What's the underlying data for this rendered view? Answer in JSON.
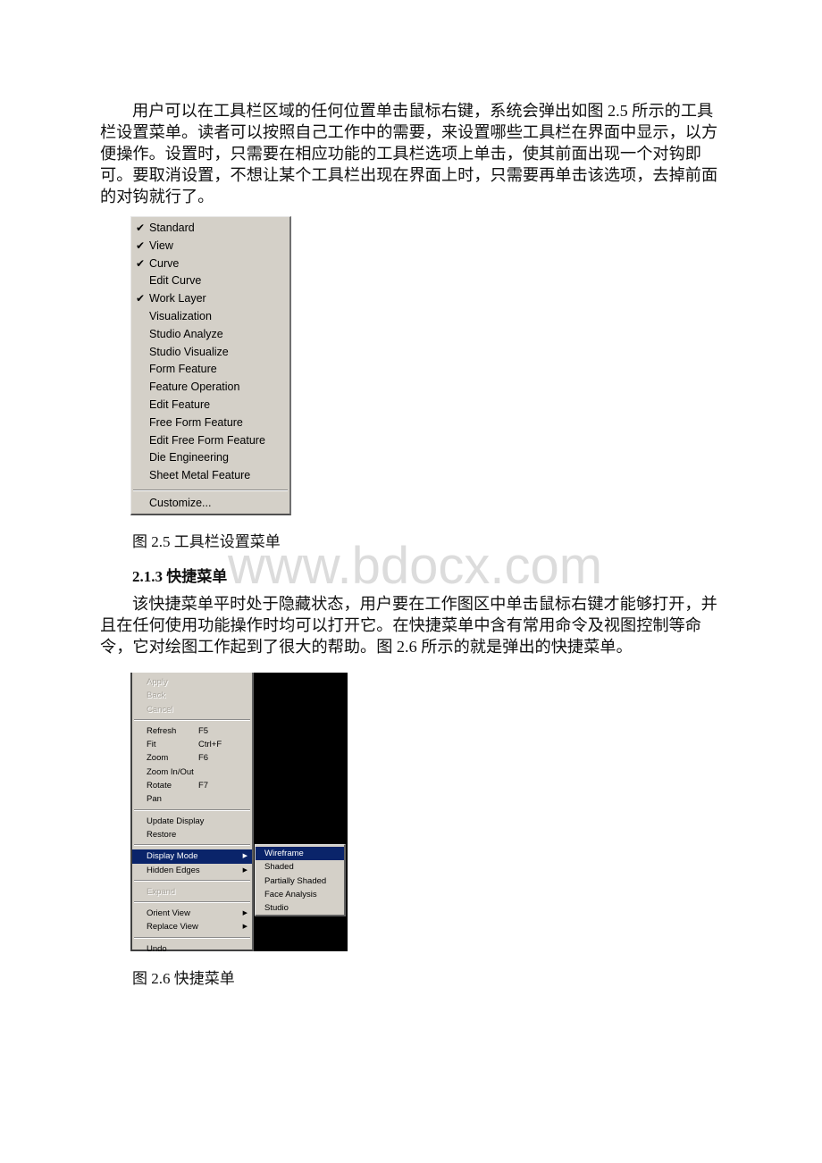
{
  "paragraph1": "用户可以在工具栏区域的任何位置单击鼠标右键，系统会弹出如图 2.5 所示的工具栏设置菜单。读者可以按照自己工作中的需要，来设置哪些工具栏在界面中显示，以方便操作。设置时，只需要在相应功能的工具栏选项上单击，使其前面出现一个对钩即可。要取消设置，不想让某个工具栏出现在界面上时，只需要再单击该选项，去掉前面的对钩就行了。",
  "toolbar_menu": {
    "check_glyph": "✔",
    "items": [
      {
        "label": "Standard",
        "checked": true
      },
      {
        "label": "View",
        "checked": true
      },
      {
        "label": "Curve",
        "checked": true
      },
      {
        "label": "Edit Curve",
        "checked": false
      },
      {
        "label": "Work Layer",
        "checked": true
      },
      {
        "label": "Visualization",
        "checked": false
      },
      {
        "label": "Studio Analyze",
        "checked": false
      },
      {
        "label": "Studio Visualize",
        "checked": false
      },
      {
        "label": "Form Feature",
        "checked": false
      },
      {
        "label": "Feature Operation",
        "checked": false
      },
      {
        "label": "Edit Feature",
        "checked": false
      },
      {
        "label": "Free Form Feature",
        "checked": false
      },
      {
        "label": "Edit Free Form Feature",
        "checked": false
      },
      {
        "label": "Die Engineering",
        "checked": false
      },
      {
        "label": "Sheet Metal Feature",
        "checked": false
      }
    ],
    "customize_label": "Customize..."
  },
  "caption1": "图 2.5 工具栏设置菜单",
  "section_heading": "2.1.3 快捷菜单",
  "watermark": "www.bdocx.com",
  "paragraph2": "该快捷菜单平时处于隐藏状态，用户要在工作图区中单击鼠标右键才能够打开，并且在任何使用功能操作时均可以打开它。在快捷菜单中含有常用命令及视图控制等命令，它对绘图工作起到了很大的帮助。图 2.6 所示的就是弹出的快捷菜单。",
  "shortcut_menu": {
    "groups": [
      [
        {
          "label": "Apply",
          "disabled": true
        },
        {
          "label": "Back",
          "disabled": true
        },
        {
          "label": "Cancel",
          "disabled": true
        }
      ],
      [
        {
          "label": "Refresh",
          "shortcut": "F5"
        },
        {
          "label": "Fit",
          "shortcut": "Ctrl+F"
        },
        {
          "label": "Zoom",
          "shortcut": "F6"
        },
        {
          "label": "Zoom In/Out"
        },
        {
          "label": "Rotate",
          "shortcut": "F7"
        },
        {
          "label": "Pan"
        }
      ],
      [
        {
          "label": "Update Display"
        },
        {
          "label": "Restore"
        }
      ],
      [
        {
          "label": "Display Mode",
          "submenu": true,
          "highlighted": true
        },
        {
          "label": "Hidden Edges",
          "submenu": true
        }
      ],
      [
        {
          "label": "Expand",
          "disabled": true
        }
      ],
      [
        {
          "label": "Orient View",
          "submenu": true
        },
        {
          "label": "Replace View",
          "submenu": true
        }
      ],
      [
        {
          "label": "Undo"
        }
      ]
    ],
    "submenu_arrow": "▶",
    "display_mode_submenu": [
      {
        "label": "Wireframe",
        "highlighted": true
      },
      {
        "label": "Shaded"
      },
      {
        "label": "Partially Shaded"
      },
      {
        "label": "Face Analysis"
      },
      {
        "label": "Studio"
      }
    ],
    "colors": {
      "highlight": "#0a246a",
      "menu_bg": "#d4d0c8",
      "canvas_bg": "#000000"
    }
  },
  "caption2": "图 2.6 快捷菜单"
}
